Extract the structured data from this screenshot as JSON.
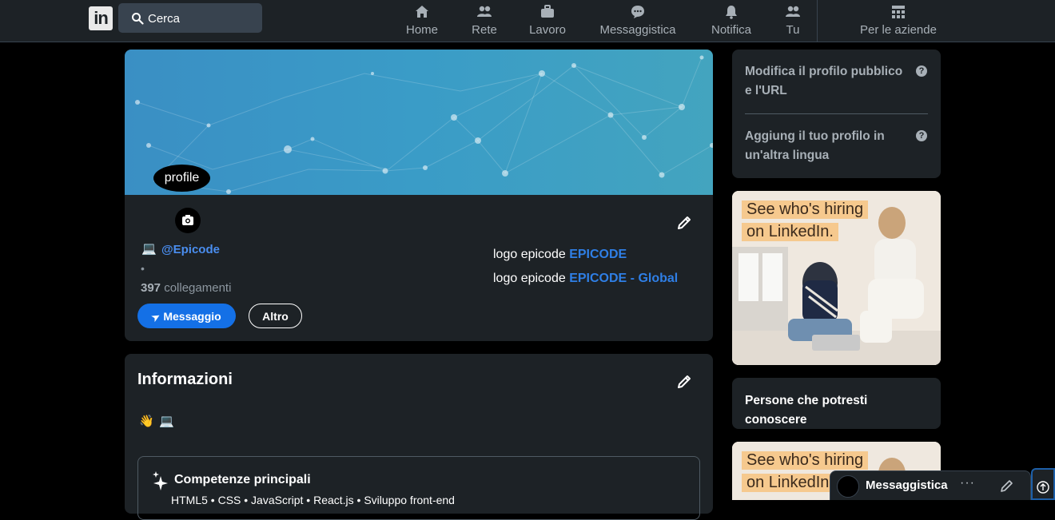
{
  "nav": {
    "logo": "in",
    "search_placeholder": "Cerca",
    "items": [
      {
        "label": "Home"
      },
      {
        "label": "Rete"
      },
      {
        "label": "Lavoro"
      },
      {
        "label": "Messaggistica"
      },
      {
        "label": "Notifica"
      },
      {
        "label": "Tu"
      },
      {
        "label": "Per le aziende"
      }
    ]
  },
  "profile": {
    "avatar_alt": "profile",
    "handle": "@Epicode",
    "bullet": "•",
    "connections_count": "397",
    "connections_label": "collegamenti",
    "message_button": "Messaggio",
    "more_button": "Altro",
    "experiences": [
      {
        "alt": "logo epicode",
        "link": "EPICODE"
      },
      {
        "alt": "logo epicode",
        "link": "EPICODE - Global"
      }
    ]
  },
  "info": {
    "title": "Informazioni",
    "skills_title": "Competenze principali",
    "skills_list": "HTML5 • CSS • JavaScript • React.js • Sviluppo front-end"
  },
  "sidebar": {
    "edit_profile_link": "Modifica il profilo pubblico e l'URL",
    "add_language_link": "Aggiung il tuo profilo in un'altra lingua",
    "help_glyph": "?",
    "ad_line1": "See who's hiring",
    "ad_line2": "on LinkedIn.",
    "people_title": "Persone che potresti conoscere"
  },
  "messaging": {
    "label": "Messaggistica",
    "more": "···"
  },
  "colors": {
    "nav_bg": "#1d2226",
    "card_bg": "#1d2226",
    "accent_blue": "#1470e6",
    "ad_highlight": "#f6c98e"
  }
}
